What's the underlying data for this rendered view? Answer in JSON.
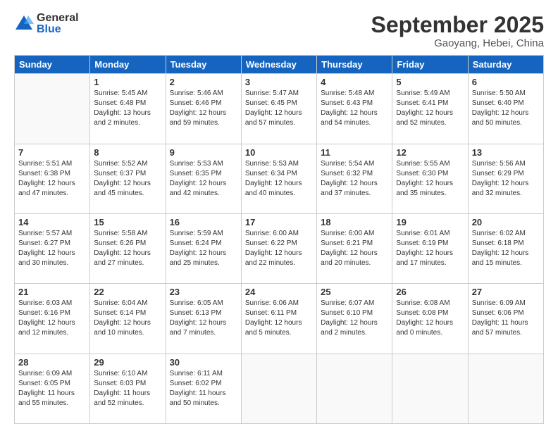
{
  "logo": {
    "general": "General",
    "blue": "Blue"
  },
  "header": {
    "month": "September 2025",
    "location": "Gaoyang, Hebei, China"
  },
  "weekdays": [
    "Sunday",
    "Monday",
    "Tuesday",
    "Wednesday",
    "Thursday",
    "Friday",
    "Saturday"
  ],
  "weeks": [
    [
      {
        "day": "",
        "info": ""
      },
      {
        "day": "1",
        "info": "Sunrise: 5:45 AM\nSunset: 6:48 PM\nDaylight: 13 hours\nand 2 minutes."
      },
      {
        "day": "2",
        "info": "Sunrise: 5:46 AM\nSunset: 6:46 PM\nDaylight: 12 hours\nand 59 minutes."
      },
      {
        "day": "3",
        "info": "Sunrise: 5:47 AM\nSunset: 6:45 PM\nDaylight: 12 hours\nand 57 minutes."
      },
      {
        "day": "4",
        "info": "Sunrise: 5:48 AM\nSunset: 6:43 PM\nDaylight: 12 hours\nand 54 minutes."
      },
      {
        "day": "5",
        "info": "Sunrise: 5:49 AM\nSunset: 6:41 PM\nDaylight: 12 hours\nand 52 minutes."
      },
      {
        "day": "6",
        "info": "Sunrise: 5:50 AM\nSunset: 6:40 PM\nDaylight: 12 hours\nand 50 minutes."
      }
    ],
    [
      {
        "day": "7",
        "info": "Sunrise: 5:51 AM\nSunset: 6:38 PM\nDaylight: 12 hours\nand 47 minutes."
      },
      {
        "day": "8",
        "info": "Sunrise: 5:52 AM\nSunset: 6:37 PM\nDaylight: 12 hours\nand 45 minutes."
      },
      {
        "day": "9",
        "info": "Sunrise: 5:53 AM\nSunset: 6:35 PM\nDaylight: 12 hours\nand 42 minutes."
      },
      {
        "day": "10",
        "info": "Sunrise: 5:53 AM\nSunset: 6:34 PM\nDaylight: 12 hours\nand 40 minutes."
      },
      {
        "day": "11",
        "info": "Sunrise: 5:54 AM\nSunset: 6:32 PM\nDaylight: 12 hours\nand 37 minutes."
      },
      {
        "day": "12",
        "info": "Sunrise: 5:55 AM\nSunset: 6:30 PM\nDaylight: 12 hours\nand 35 minutes."
      },
      {
        "day": "13",
        "info": "Sunrise: 5:56 AM\nSunset: 6:29 PM\nDaylight: 12 hours\nand 32 minutes."
      }
    ],
    [
      {
        "day": "14",
        "info": "Sunrise: 5:57 AM\nSunset: 6:27 PM\nDaylight: 12 hours\nand 30 minutes."
      },
      {
        "day": "15",
        "info": "Sunrise: 5:58 AM\nSunset: 6:26 PM\nDaylight: 12 hours\nand 27 minutes."
      },
      {
        "day": "16",
        "info": "Sunrise: 5:59 AM\nSunset: 6:24 PM\nDaylight: 12 hours\nand 25 minutes."
      },
      {
        "day": "17",
        "info": "Sunrise: 6:00 AM\nSunset: 6:22 PM\nDaylight: 12 hours\nand 22 minutes."
      },
      {
        "day": "18",
        "info": "Sunrise: 6:00 AM\nSunset: 6:21 PM\nDaylight: 12 hours\nand 20 minutes."
      },
      {
        "day": "19",
        "info": "Sunrise: 6:01 AM\nSunset: 6:19 PM\nDaylight: 12 hours\nand 17 minutes."
      },
      {
        "day": "20",
        "info": "Sunrise: 6:02 AM\nSunset: 6:18 PM\nDaylight: 12 hours\nand 15 minutes."
      }
    ],
    [
      {
        "day": "21",
        "info": "Sunrise: 6:03 AM\nSunset: 6:16 PM\nDaylight: 12 hours\nand 12 minutes."
      },
      {
        "day": "22",
        "info": "Sunrise: 6:04 AM\nSunset: 6:14 PM\nDaylight: 12 hours\nand 10 minutes."
      },
      {
        "day": "23",
        "info": "Sunrise: 6:05 AM\nSunset: 6:13 PM\nDaylight: 12 hours\nand 7 minutes."
      },
      {
        "day": "24",
        "info": "Sunrise: 6:06 AM\nSunset: 6:11 PM\nDaylight: 12 hours\nand 5 minutes."
      },
      {
        "day": "25",
        "info": "Sunrise: 6:07 AM\nSunset: 6:10 PM\nDaylight: 12 hours\nand 2 minutes."
      },
      {
        "day": "26",
        "info": "Sunrise: 6:08 AM\nSunset: 6:08 PM\nDaylight: 12 hours\nand 0 minutes."
      },
      {
        "day": "27",
        "info": "Sunrise: 6:09 AM\nSunset: 6:06 PM\nDaylight: 11 hours\nand 57 minutes."
      }
    ],
    [
      {
        "day": "28",
        "info": "Sunrise: 6:09 AM\nSunset: 6:05 PM\nDaylight: 11 hours\nand 55 minutes."
      },
      {
        "day": "29",
        "info": "Sunrise: 6:10 AM\nSunset: 6:03 PM\nDaylight: 11 hours\nand 52 minutes."
      },
      {
        "day": "30",
        "info": "Sunrise: 6:11 AM\nSunset: 6:02 PM\nDaylight: 11 hours\nand 50 minutes."
      },
      {
        "day": "",
        "info": ""
      },
      {
        "day": "",
        "info": ""
      },
      {
        "day": "",
        "info": ""
      },
      {
        "day": "",
        "info": ""
      }
    ]
  ]
}
